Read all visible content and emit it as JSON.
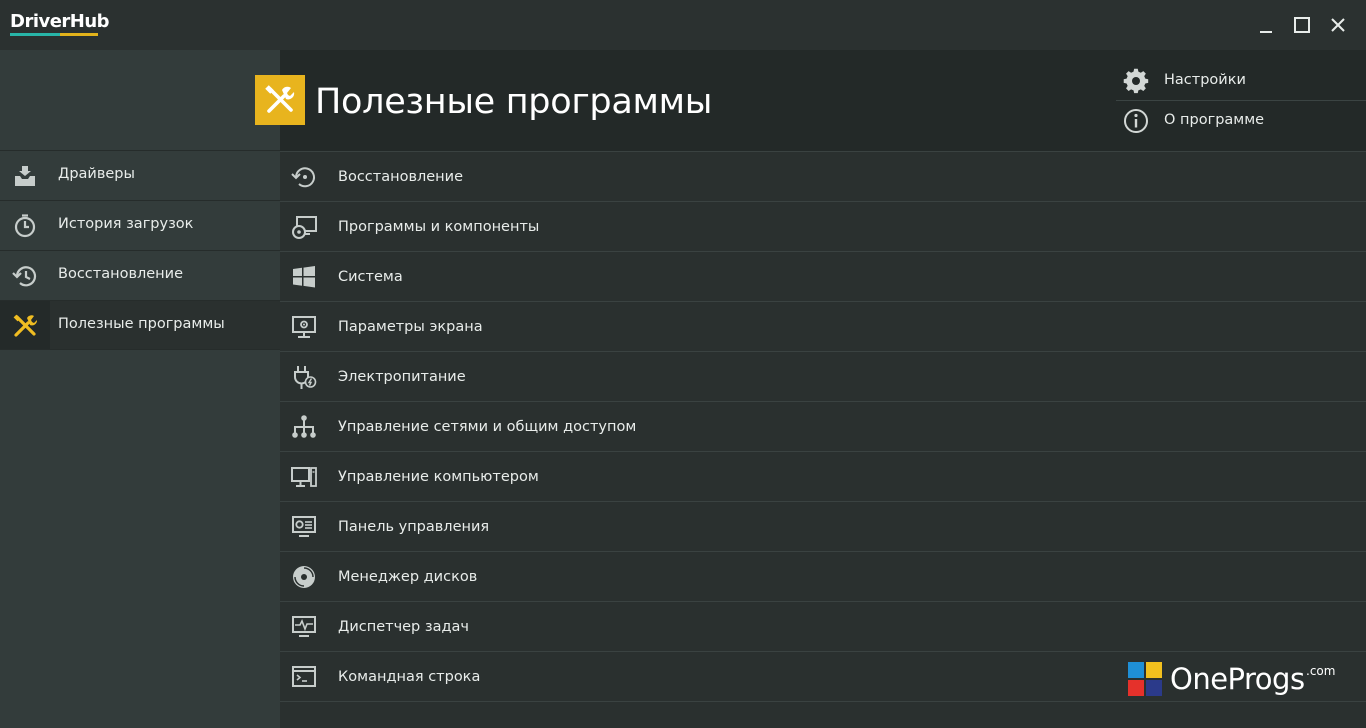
{
  "app": {
    "logo_text": "DriverHub",
    "logo_colors": {
      "teal": "#28b5a8",
      "yellow": "#e3b31b"
    }
  },
  "window_controls": [
    "minimize-icon",
    "maximize-icon",
    "close-icon"
  ],
  "sidebar": {
    "items": [
      {
        "label": "Драйверы",
        "icon": "drivers-tray-icon",
        "active": false
      },
      {
        "label": "История загрузок",
        "icon": "stopwatch-icon",
        "active": false
      },
      {
        "label": "Восстановление",
        "icon": "history-restore-icon",
        "active": false
      },
      {
        "label": "Полезные программы",
        "icon": "tools-icon",
        "active": true
      }
    ]
  },
  "header": {
    "title": "Полезные программы",
    "icon": "tools-icon",
    "accent": "#e8b41e",
    "links": [
      {
        "label": "Настройки",
        "icon": "gear-icon"
      },
      {
        "label": "О программе",
        "icon": "info-icon"
      }
    ]
  },
  "main": {
    "items": [
      {
        "label": "Восстановление",
        "icon": "restore-icon"
      },
      {
        "label": "Программы и компоненты",
        "icon": "programs-components-icon"
      },
      {
        "label": "Система",
        "icon": "windows-logo-icon"
      },
      {
        "label": "Параметры экрана",
        "icon": "display-settings-icon"
      },
      {
        "label": "Электропитание",
        "icon": "power-plug-icon"
      },
      {
        "label": "Управление сетями и общим доступом",
        "icon": "network-icon"
      },
      {
        "label": "Управление компьютером",
        "icon": "computer-icon"
      },
      {
        "label": "Панель управления",
        "icon": "control-panel-icon"
      },
      {
        "label": "Менеджер дисков",
        "icon": "disk-icon"
      },
      {
        "label": "Диспетчер задач",
        "icon": "task-manager-icon"
      },
      {
        "label": "Командная строка",
        "icon": "command-line-icon"
      }
    ]
  },
  "watermark": {
    "text": "OneProgs",
    "suffix": ".com",
    "colors": [
      "#1f8fd6",
      "#f2c01e",
      "#e5312b",
      "#2b3a8a"
    ]
  }
}
